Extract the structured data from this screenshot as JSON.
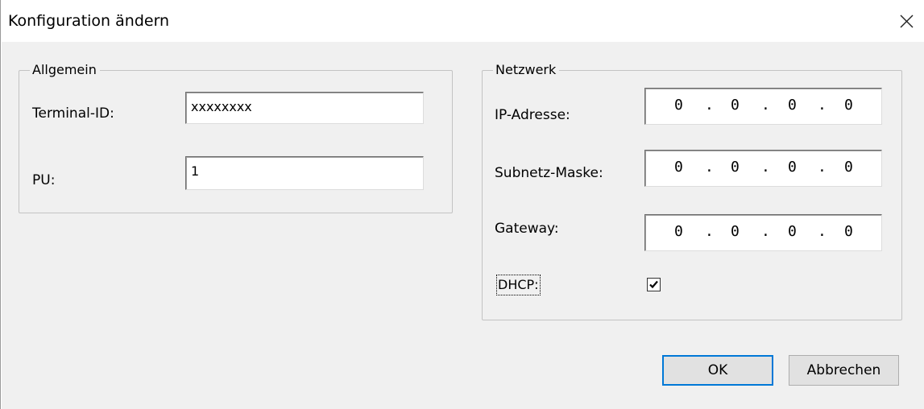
{
  "window": {
    "title": "Konfiguration ändern",
    "close_icon": "close-icon"
  },
  "general": {
    "legend": "Allgemein",
    "terminal_id_label": "Terminal-ID:",
    "terminal_id_value": "xxxxxxxx",
    "pu_label": "PU:",
    "pu_value": "1"
  },
  "network": {
    "legend": "Netzwerk",
    "ip_label": "IP-Adresse:",
    "ip": [
      "0",
      "0",
      "0",
      "0"
    ],
    "subnet_label": "Subnetz-Maske:",
    "subnet": [
      "0",
      "0",
      "0",
      "0"
    ],
    "gateway_label": "Gateway:",
    "gateway": [
      "0",
      "0",
      "0",
      "0"
    ],
    "dhcp_label": "DHCP:",
    "dhcp_checked": true,
    "separator": "."
  },
  "buttons": {
    "ok": "OK",
    "cancel": "Abbrechen"
  }
}
